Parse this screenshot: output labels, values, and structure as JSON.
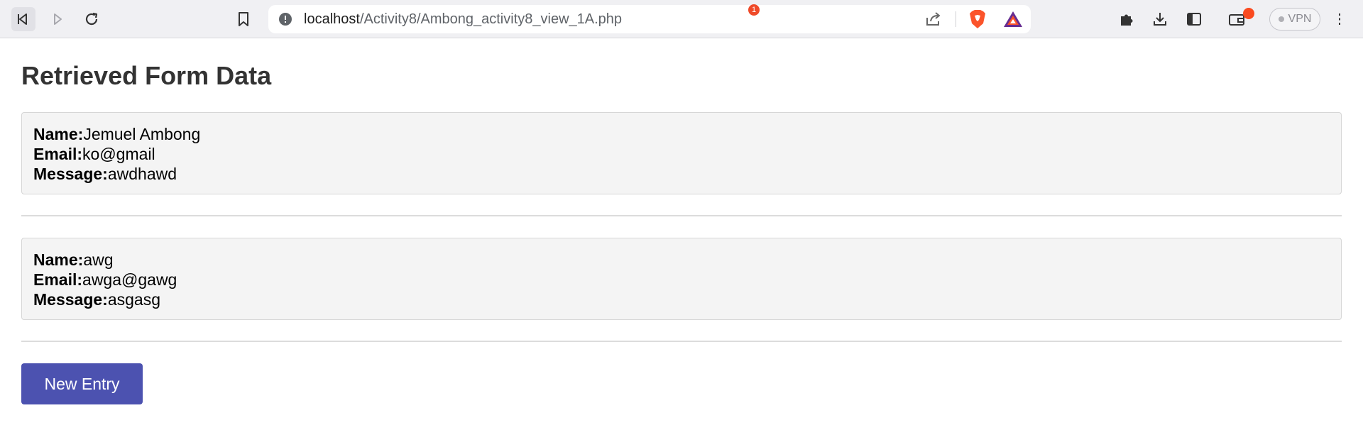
{
  "browser": {
    "url_host": "localhost",
    "url_path": "/Activity8/Ambong_activity8_view_1A.php",
    "rewards_badge_count": "1",
    "vpn_label": "VPN",
    "icons": [
      "back-icon",
      "forward-icon",
      "reload-icon",
      "bookmark-icon",
      "info-icon",
      "share-icon",
      "brave-shield-icon",
      "brave-rewards-icon",
      "extensions-icon",
      "download-icon",
      "sidebar-icon",
      "wallet-icon",
      "menu-icon"
    ]
  },
  "page": {
    "title": "Retrieved Form Data",
    "field_labels": {
      "name": "Name:",
      "email": "Email:",
      "message": "Message:"
    },
    "entries": [
      {
        "name": "Jemuel Ambong",
        "email": "ko@gmail",
        "message": "awdhawd"
      },
      {
        "name": "awg",
        "email": "awga@gawg",
        "message": "asgasg"
      }
    ],
    "new_entry_label": "New Entry",
    "colors": {
      "button": "#4c52b0",
      "card_bg": "#f4f4f4",
      "title": "#333333"
    }
  }
}
